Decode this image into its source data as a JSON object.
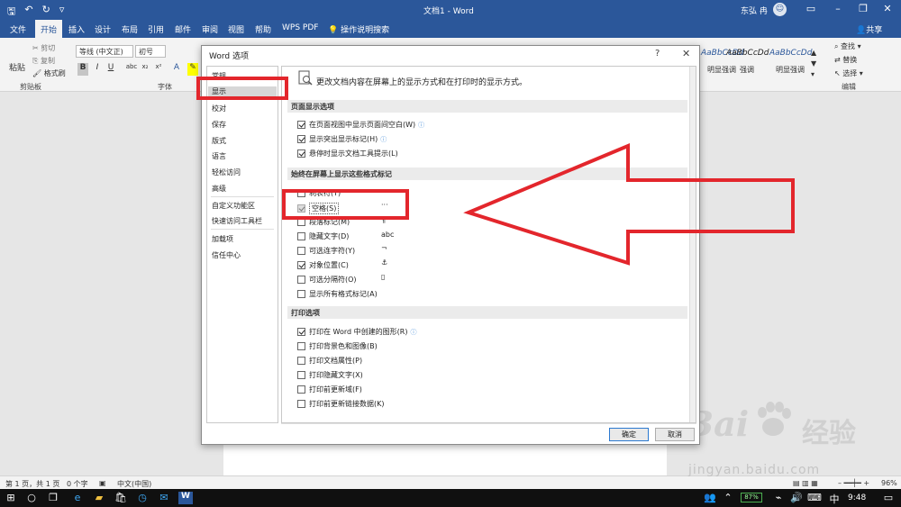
{
  "titlebar": {
    "doc_title": "文档1 - Word",
    "user_name": "东弘 冉",
    "avatar_glyph": "☺"
  },
  "tabs": [
    {
      "label": "文件"
    },
    {
      "label": "开始"
    },
    {
      "label": "插入"
    },
    {
      "label": "设计"
    },
    {
      "label": "布局"
    },
    {
      "label": "引用"
    },
    {
      "label": "邮件"
    },
    {
      "label": "审阅"
    },
    {
      "label": "视图"
    },
    {
      "label": "帮助"
    },
    {
      "label": "WPS PDF"
    }
  ],
  "tell_me": "操作说明搜索",
  "share": "共享",
  "ribbon": {
    "clipboard": {
      "paste": "粘贴",
      "cut": "剪切",
      "copy": "复制",
      "format_painter": "格式刷",
      "group": "剪贴板"
    },
    "font": {
      "font_name": "等线 (中文正)",
      "font_size": "初号",
      "group": "字体"
    },
    "styles": [
      {
        "sample": "AaBbCcDd",
        "name": "明显强调"
      },
      {
        "sample": "AaBbCcDd",
        "name": "强调"
      },
      {
        "sample": "AaBbCcDd",
        "name": "明显强调"
      }
    ],
    "editing": {
      "find": "查找",
      "replace": "替换",
      "select": "选择",
      "group": "编辑"
    }
  },
  "dialog": {
    "title": "Word 选项",
    "help": "?",
    "close": "✕",
    "nav": [
      {
        "label": "常规"
      },
      {
        "label": "显示"
      },
      {
        "label": "校对"
      },
      {
        "label": "保存"
      },
      {
        "label": "版式"
      },
      {
        "label": "语言"
      },
      {
        "label": "轻松访问"
      },
      {
        "label": "高级"
      },
      {
        "label": "自定义功能区"
      },
      {
        "label": "快速访问工具栏"
      },
      {
        "label": "加载项"
      },
      {
        "label": "信任中心"
      }
    ],
    "lead": "更改文档内容在屏幕上的显示方式和在打印时的显示方式。",
    "sections": {
      "page_display": {
        "header": "页面显示选项",
        "options": [
          {
            "label": "在页面视图中显示页面间空白(W)",
            "checked": true
          },
          {
            "label": "显示突出显示标记(H)",
            "checked": true
          },
          {
            "label": "悬停时显示文档工具提示(L)",
            "checked": true
          }
        ]
      },
      "format_marks": {
        "header": "始终在屏幕上显示这些格式标记",
        "options": [
          {
            "label": "制表符(T)",
            "checked": false,
            "mark": "→"
          },
          {
            "label": "空格(S)",
            "checked": true,
            "mark": "···"
          },
          {
            "label": "段落标记(M)",
            "checked": false,
            "mark": "¶"
          },
          {
            "label": "隐藏文字(D)",
            "checked": false,
            "mark": "abc"
          },
          {
            "label": "可选连字符(Y)",
            "checked": false,
            "mark": "¬"
          },
          {
            "label": "对象位置(C)",
            "checked": true,
            "mark": "⚓"
          },
          {
            "label": "可选分隔符(O)",
            "checked": false,
            "mark": "▯"
          },
          {
            "label": "显示所有格式标记(A)",
            "checked": false,
            "mark": ""
          }
        ]
      },
      "print": {
        "header": "打印选项",
        "options": [
          {
            "label": "打印在 Word 中创建的图形(R)",
            "checked": true
          },
          {
            "label": "打印背景色和图像(B)",
            "checked": false
          },
          {
            "label": "打印文档属性(P)",
            "checked": false
          },
          {
            "label": "打印隐藏文字(X)",
            "checked": false
          },
          {
            "label": "打印前更新域(F)",
            "checked": false
          },
          {
            "label": "打印前更新链接数据(K)",
            "checked": false
          }
        ]
      }
    },
    "ok": "确定",
    "cancel": "取消"
  },
  "statusbar": {
    "page": "第 1 页，共 1 页",
    "words": "0 个字",
    "language": "中文(中国)",
    "zoom": "96%"
  },
  "taskbar": {
    "battery": "87%",
    "time": "9:48"
  },
  "watermark": {
    "brand": "Bai",
    "brand_cn": "经验",
    "url": "jingyan.baidu.com"
  },
  "colors": {
    "word_blue": "#2b579a",
    "annotation_red": "#e3262c"
  }
}
